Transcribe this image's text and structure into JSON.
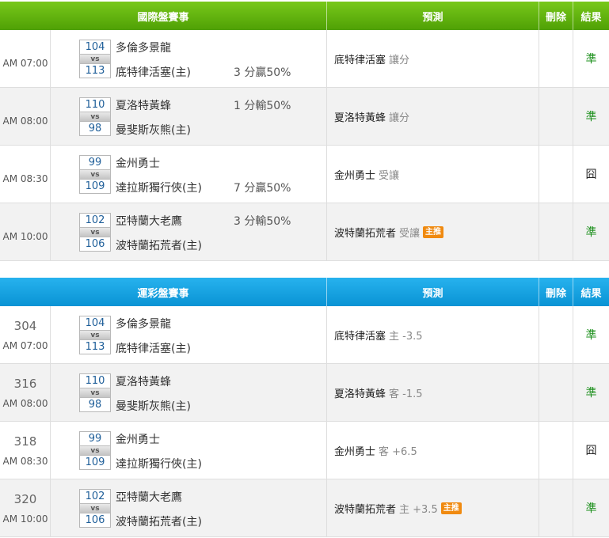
{
  "tables": [
    {
      "header": {
        "game": "國際盤賽事",
        "prediction": "預測",
        "delete": "刪除",
        "result": "結果"
      },
      "rows": [
        {
          "num": "",
          "time": "AM 07:00",
          "away_score": "104",
          "home_score": "113",
          "away": "多倫多景龍",
          "home": "底特律活塞(主)",
          "spread_top": "",
          "spread_bottom": "3 分贏50%",
          "pred_team": "底特律活塞",
          "pred_note": "讓分",
          "badge": "",
          "result": "準",
          "result_ok": true
        },
        {
          "num": "",
          "time": "AM 08:00",
          "away_score": "110",
          "home_score": "98",
          "away": "夏洛特黃蜂",
          "home": "曼斐斯灰熊(主)",
          "spread_top": "1 分輸50%",
          "spread_bottom": "",
          "pred_team": "夏洛特黃蜂",
          "pred_note": "讓分",
          "badge": "",
          "result": "準",
          "result_ok": true
        },
        {
          "num": "",
          "time": "AM 08:30",
          "away_score": "99",
          "home_score": "109",
          "away": "金州勇士",
          "home": "達拉斯獨行俠(主)",
          "spread_top": "",
          "spread_bottom": "7 分贏50%",
          "pred_team": "金州勇士",
          "pred_note": "受讓",
          "badge": "",
          "result": "囧",
          "result_ok": false
        },
        {
          "num": "",
          "time": "AM 10:00",
          "away_score": "102",
          "home_score": "106",
          "away": "亞特蘭大老鷹",
          "home": "波特蘭拓荒者(主)",
          "spread_top": "3 分輸50%",
          "spread_bottom": "",
          "pred_team": "波特蘭拓荒者",
          "pred_note": "受讓",
          "badge": "主推",
          "result": "準",
          "result_ok": true
        }
      ]
    },
    {
      "header": {
        "game": "運彩盤賽事",
        "prediction": "預測",
        "delete": "刪除",
        "result": "結果"
      },
      "rows": [
        {
          "num": "304",
          "time": "AM 07:00",
          "away_score": "104",
          "home_score": "113",
          "away": "多倫多景龍",
          "home": "底特律活塞(主)",
          "spread_top": "",
          "spread_bottom": "",
          "pred_team": "底特律活塞",
          "pred_note": "主 -3.5",
          "badge": "",
          "result": "準",
          "result_ok": true
        },
        {
          "num": "316",
          "time": "AM 08:00",
          "away_score": "110",
          "home_score": "98",
          "away": "夏洛特黃蜂",
          "home": "曼斐斯灰熊(主)",
          "spread_top": "",
          "spread_bottom": "",
          "pred_team": "夏洛特黃蜂",
          "pred_note": "客 -1.5",
          "badge": "",
          "result": "準",
          "result_ok": true
        },
        {
          "num": "318",
          "time": "AM 08:30",
          "away_score": "99",
          "home_score": "109",
          "away": "金州勇士",
          "home": "達拉斯獨行俠(主)",
          "spread_top": "",
          "spread_bottom": "",
          "pred_team": "金州勇士",
          "pred_note": "客 +6.5",
          "badge": "",
          "result": "囧",
          "result_ok": false
        },
        {
          "num": "320",
          "time": "AM 10:00",
          "away_score": "102",
          "home_score": "106",
          "away": "亞特蘭大老鷹",
          "home": "波特蘭拓荒者(主)",
          "spread_top": "",
          "spread_bottom": "",
          "pred_team": "波特蘭拓荒者",
          "pred_note": "主 +3.5",
          "badge": "主推",
          "result": "準",
          "result_ok": true
        }
      ]
    }
  ],
  "colors": {
    "header_green": "#5fb30e",
    "header_blue": "#139fe0",
    "result_ok": "#1a8f1a",
    "badge": "#f08a10"
  }
}
